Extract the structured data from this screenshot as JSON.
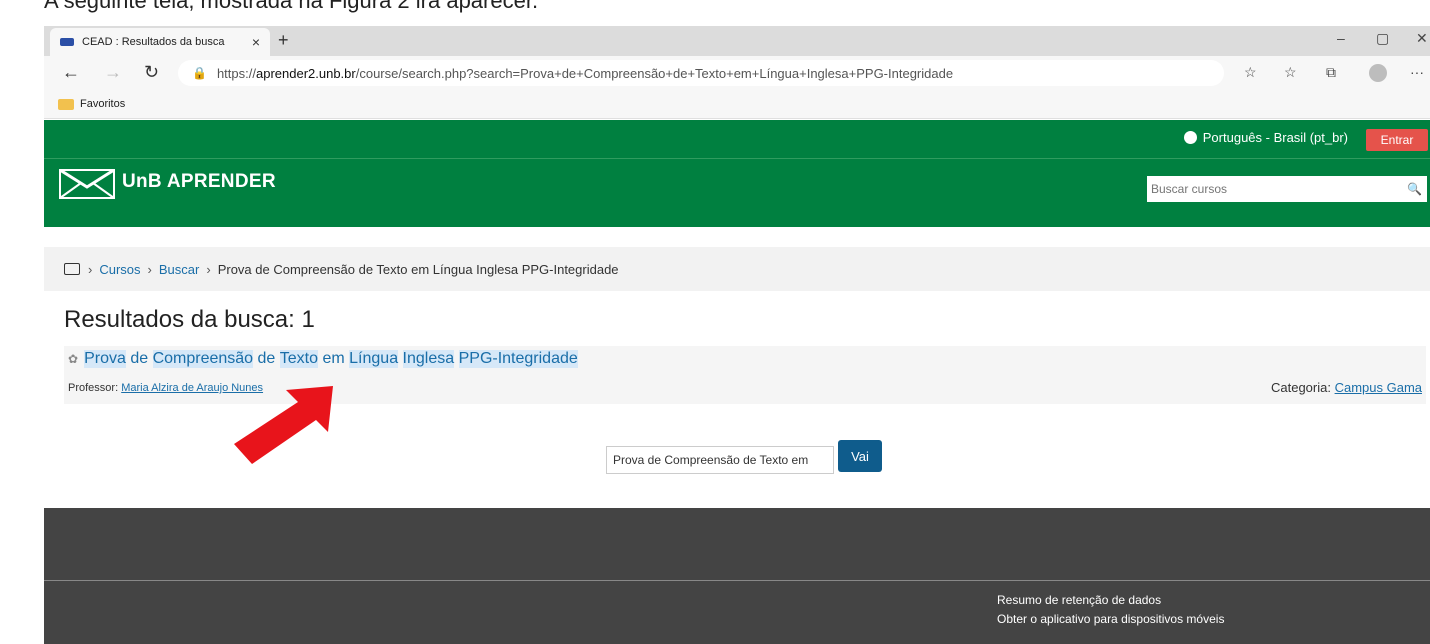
{
  "caption": "A seguinte tela, mostrada na Figura 2 irá aparecer.",
  "browser": {
    "tab_title": "CEAD : Resultados da busca",
    "tab_close": "×",
    "new_tab": "+",
    "url_prefix": "https://",
    "url_host": "aprender2.unb.br",
    "url_path": "/course/search.php?search=Prova+de+Compreensão+de+Texto+em+Língua+Inglesa+PPG-Integridade",
    "favorites_label": "Favoritos"
  },
  "site": {
    "language": "Português - Brasil (pt_br)",
    "login_label": "Entrar",
    "brand": "UnB APRENDER",
    "search_placeholder": "Buscar cursos",
    "brand_color": "#008040"
  },
  "breadcrumb": {
    "items": [
      "Cursos",
      "Buscar"
    ],
    "current": "Prova de Compreensão de Texto em Língua Inglesa PPG-Integridade"
  },
  "results": {
    "heading": "Resultados da busca: 1",
    "course_words": [
      "Prova",
      "de",
      "Compreensão",
      "de",
      "Texto",
      "em",
      "Língua",
      "Inglesa",
      "PPG-Integridade"
    ],
    "teacher_label": "Professor: ",
    "teacher_name": "Maria Alzira de Araujo Nunes",
    "category_label": "Categoria: ",
    "category_name": "Campus Gama"
  },
  "search_form": {
    "value": "Prova de Compreensão de Texto em",
    "button": "Vai"
  },
  "footer": {
    "links": [
      "Resumo de retenção de dados",
      "Obter o aplicativo para dispositivos móveis"
    ]
  }
}
